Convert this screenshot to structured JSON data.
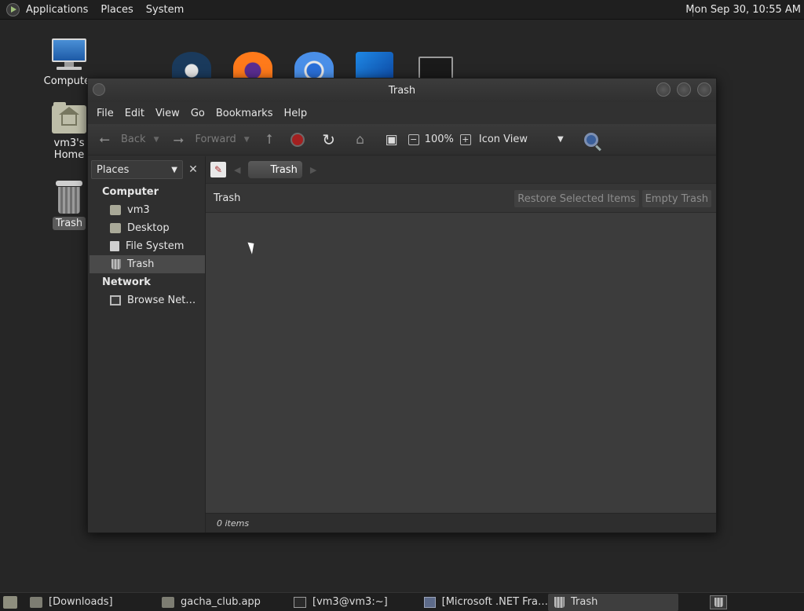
{
  "top_panel": {
    "menus": [
      "Applications",
      "Places",
      "System"
    ],
    "clock": "Mon Sep 30, 10:55 AM"
  },
  "desktop": {
    "icons": [
      {
        "label": "Computer",
        "icon": "computer-icon"
      },
      {
        "label": "vm3's Home",
        "icon": "home-folder-icon"
      },
      {
        "label": "Trash",
        "icon": "trash-icon"
      }
    ],
    "dock_icons": [
      "steam-icon",
      "firefox-icon",
      "chromium-icon",
      "vscode-icon",
      "terminal-icon"
    ]
  },
  "window": {
    "title": "Trash",
    "menu": [
      "File",
      "Edit",
      "View",
      "Go",
      "Bookmarks",
      "Help"
    ],
    "toolbar": {
      "back_label": "Back",
      "forward_label": "Forward",
      "zoom": "100%",
      "view_mode": "Icon View"
    },
    "sidebar": {
      "selector": "Places",
      "sections": [
        {
          "heading": "Computer",
          "items": [
            "vm3",
            "Desktop",
            "File System",
            "Trash"
          ]
        },
        {
          "heading": "Network",
          "items": [
            "Browse Net…"
          ]
        }
      ],
      "active_item": "Trash"
    },
    "path": {
      "crumb": "Trash"
    },
    "info_bar": {
      "label": "Trash",
      "restore_label": "Restore Selected Items",
      "empty_label": "Empty Trash"
    },
    "status": "0 items"
  },
  "taskbar": {
    "tasks": [
      {
        "label": "[Downloads]",
        "icon": "folder-icon"
      },
      {
        "label": "gacha_club.app",
        "icon": "folder-icon"
      },
      {
        "label": "[vm3@vm3:~]",
        "icon": "terminal-icon"
      },
      {
        "label": "[Microsoft .NET Fra…",
        "icon": "window-icon"
      },
      {
        "label": "Trash",
        "icon": "trash-icon"
      }
    ]
  },
  "colors": {
    "desktop_bg": "#262626",
    "panel_bg": "#1f1f1f",
    "window_bg": "#2f2f2f",
    "content_bg": "#3c3c3c",
    "stop_red": "#a32020"
  }
}
